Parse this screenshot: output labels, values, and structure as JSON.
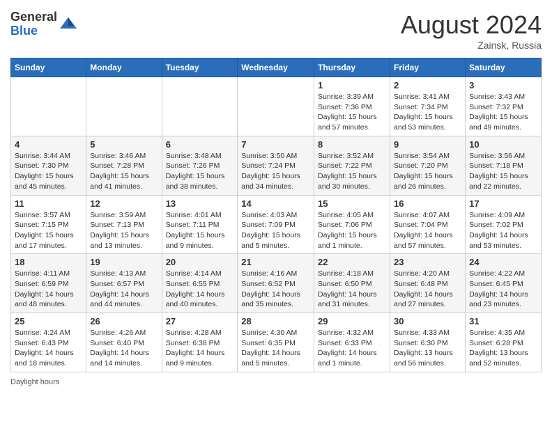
{
  "header": {
    "logo_general": "General",
    "logo_blue": "Blue",
    "month_year": "August 2024",
    "location": "Zainsk, Russia"
  },
  "footer": {
    "daylight_label": "Daylight hours"
  },
  "days_of_week": [
    "Sunday",
    "Monday",
    "Tuesday",
    "Wednesday",
    "Thursday",
    "Friday",
    "Saturday"
  ],
  "weeks": [
    [
      {
        "day": "",
        "detail": ""
      },
      {
        "day": "",
        "detail": ""
      },
      {
        "day": "",
        "detail": ""
      },
      {
        "day": "",
        "detail": ""
      },
      {
        "day": "1",
        "detail": "Sunrise: 3:39 AM\nSunset: 7:36 PM\nDaylight: 15 hours and 57 minutes."
      },
      {
        "day": "2",
        "detail": "Sunrise: 3:41 AM\nSunset: 7:34 PM\nDaylight: 15 hours and 53 minutes."
      },
      {
        "day": "3",
        "detail": "Sunrise: 3:43 AM\nSunset: 7:32 PM\nDaylight: 15 hours and 49 minutes."
      }
    ],
    [
      {
        "day": "4",
        "detail": "Sunrise: 3:44 AM\nSunset: 7:30 PM\nDaylight: 15 hours and 45 minutes."
      },
      {
        "day": "5",
        "detail": "Sunrise: 3:46 AM\nSunset: 7:28 PM\nDaylight: 15 hours and 41 minutes."
      },
      {
        "day": "6",
        "detail": "Sunrise: 3:48 AM\nSunset: 7:26 PM\nDaylight: 15 hours and 38 minutes."
      },
      {
        "day": "7",
        "detail": "Sunrise: 3:50 AM\nSunset: 7:24 PM\nDaylight: 15 hours and 34 minutes."
      },
      {
        "day": "8",
        "detail": "Sunrise: 3:52 AM\nSunset: 7:22 PM\nDaylight: 15 hours and 30 minutes."
      },
      {
        "day": "9",
        "detail": "Sunrise: 3:54 AM\nSunset: 7:20 PM\nDaylight: 15 hours and 26 minutes."
      },
      {
        "day": "10",
        "detail": "Sunrise: 3:56 AM\nSunset: 7:18 PM\nDaylight: 15 hours and 22 minutes."
      }
    ],
    [
      {
        "day": "11",
        "detail": "Sunrise: 3:57 AM\nSunset: 7:15 PM\nDaylight: 15 hours and 17 minutes."
      },
      {
        "day": "12",
        "detail": "Sunrise: 3:59 AM\nSunset: 7:13 PM\nDaylight: 15 hours and 13 minutes."
      },
      {
        "day": "13",
        "detail": "Sunrise: 4:01 AM\nSunset: 7:11 PM\nDaylight: 15 hours and 9 minutes."
      },
      {
        "day": "14",
        "detail": "Sunrise: 4:03 AM\nSunset: 7:09 PM\nDaylight: 15 hours and 5 minutes."
      },
      {
        "day": "15",
        "detail": "Sunrise: 4:05 AM\nSunset: 7:06 PM\nDaylight: 15 hours and 1 minute."
      },
      {
        "day": "16",
        "detail": "Sunrise: 4:07 AM\nSunset: 7:04 PM\nDaylight: 14 hours and 57 minutes."
      },
      {
        "day": "17",
        "detail": "Sunrise: 4:09 AM\nSunset: 7:02 PM\nDaylight: 14 hours and 53 minutes."
      }
    ],
    [
      {
        "day": "18",
        "detail": "Sunrise: 4:11 AM\nSunset: 6:59 PM\nDaylight: 14 hours and 48 minutes."
      },
      {
        "day": "19",
        "detail": "Sunrise: 4:13 AM\nSunset: 6:57 PM\nDaylight: 14 hours and 44 minutes."
      },
      {
        "day": "20",
        "detail": "Sunrise: 4:14 AM\nSunset: 6:55 PM\nDaylight: 14 hours and 40 minutes."
      },
      {
        "day": "21",
        "detail": "Sunrise: 4:16 AM\nSunset: 6:52 PM\nDaylight: 14 hours and 35 minutes."
      },
      {
        "day": "22",
        "detail": "Sunrise: 4:18 AM\nSunset: 6:50 PM\nDaylight: 14 hours and 31 minutes."
      },
      {
        "day": "23",
        "detail": "Sunrise: 4:20 AM\nSunset: 6:48 PM\nDaylight: 14 hours and 27 minutes."
      },
      {
        "day": "24",
        "detail": "Sunrise: 4:22 AM\nSunset: 6:45 PM\nDaylight: 14 hours and 23 minutes."
      }
    ],
    [
      {
        "day": "25",
        "detail": "Sunrise: 4:24 AM\nSunset: 6:43 PM\nDaylight: 14 hours and 18 minutes."
      },
      {
        "day": "26",
        "detail": "Sunrise: 4:26 AM\nSunset: 6:40 PM\nDaylight: 14 hours and 14 minutes."
      },
      {
        "day": "27",
        "detail": "Sunrise: 4:28 AM\nSunset: 6:38 PM\nDaylight: 14 hours and 9 minutes."
      },
      {
        "day": "28",
        "detail": "Sunrise: 4:30 AM\nSunset: 6:35 PM\nDaylight: 14 hours and 5 minutes."
      },
      {
        "day": "29",
        "detail": "Sunrise: 4:32 AM\nSunset: 6:33 PM\nDaylight: 14 hours and 1 minute."
      },
      {
        "day": "30",
        "detail": "Sunrise: 4:33 AM\nSunset: 6:30 PM\nDaylight: 13 hours and 56 minutes."
      },
      {
        "day": "31",
        "detail": "Sunrise: 4:35 AM\nSunset: 6:28 PM\nDaylight: 13 hours and 52 minutes."
      }
    ]
  ]
}
